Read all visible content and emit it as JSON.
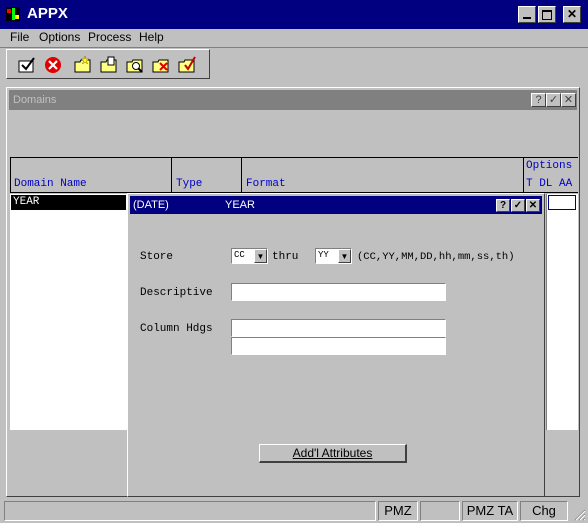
{
  "window": {
    "title": "APPX"
  },
  "menu": [
    "File",
    "Options",
    "Process",
    "Help"
  ],
  "toolbar": {
    "icons": [
      "accept-icon",
      "cancel-icon",
      "folder-new-icon",
      "folder-open-icon",
      "folder-search-icon",
      "folder-remove-icon",
      "folder-check-icon"
    ]
  },
  "domains": {
    "title": "Domains",
    "columns": {
      "name": "Domain Name",
      "type": "Type",
      "format": "Format",
      "options": "Options",
      "options_sub": "T DL AA"
    },
    "rows": [
      {
        "name": "YEAR"
      }
    ]
  },
  "dialog": {
    "type_label": "(DATE)",
    "name": "YEAR",
    "store_label": "Store",
    "store_from": "CC",
    "thru_label": "thru",
    "store_to": "YY",
    "store_hint": "(CC,YY,MM,DD,hh,mm,ss,th)",
    "descriptive_label": "Descriptive",
    "descriptive_value": "",
    "column_hdgs_label": "Column Hdgs",
    "column_hdg1": "",
    "column_hdg2": "",
    "addl_button": "Add'l Attributes"
  },
  "statusbar": {
    "cells": [
      "",
      "PMZ",
      "",
      "PMZ TA",
      "Chg"
    ]
  }
}
